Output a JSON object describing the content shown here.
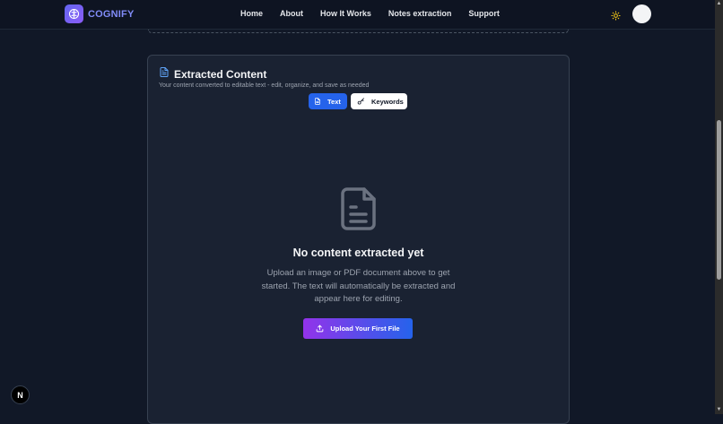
{
  "header": {
    "brand": "COGNIFY",
    "nav": [
      "Home",
      "About",
      "How It Works",
      "Notes extraction",
      "Support"
    ]
  },
  "card": {
    "title": "Extracted Content",
    "subtitle": "Your content converted to editable text - edit, organize, and save as needed",
    "tabs": [
      {
        "label": "Text",
        "icon": "document-icon",
        "active": true
      },
      {
        "label": "Keywords",
        "icon": "key-icon",
        "active": false
      }
    ],
    "empty": {
      "title": "No content extracted yet",
      "description": "Upload an image or PDF document above to get started. The text will automatically be extracted and appear here for editing.",
      "button": "Upload Your First File"
    }
  },
  "badge": "N",
  "colors": {
    "background": "#111827",
    "accent_blue": "#2563eb",
    "accent_purple": "#9333ea",
    "brand": "#818cf8"
  }
}
